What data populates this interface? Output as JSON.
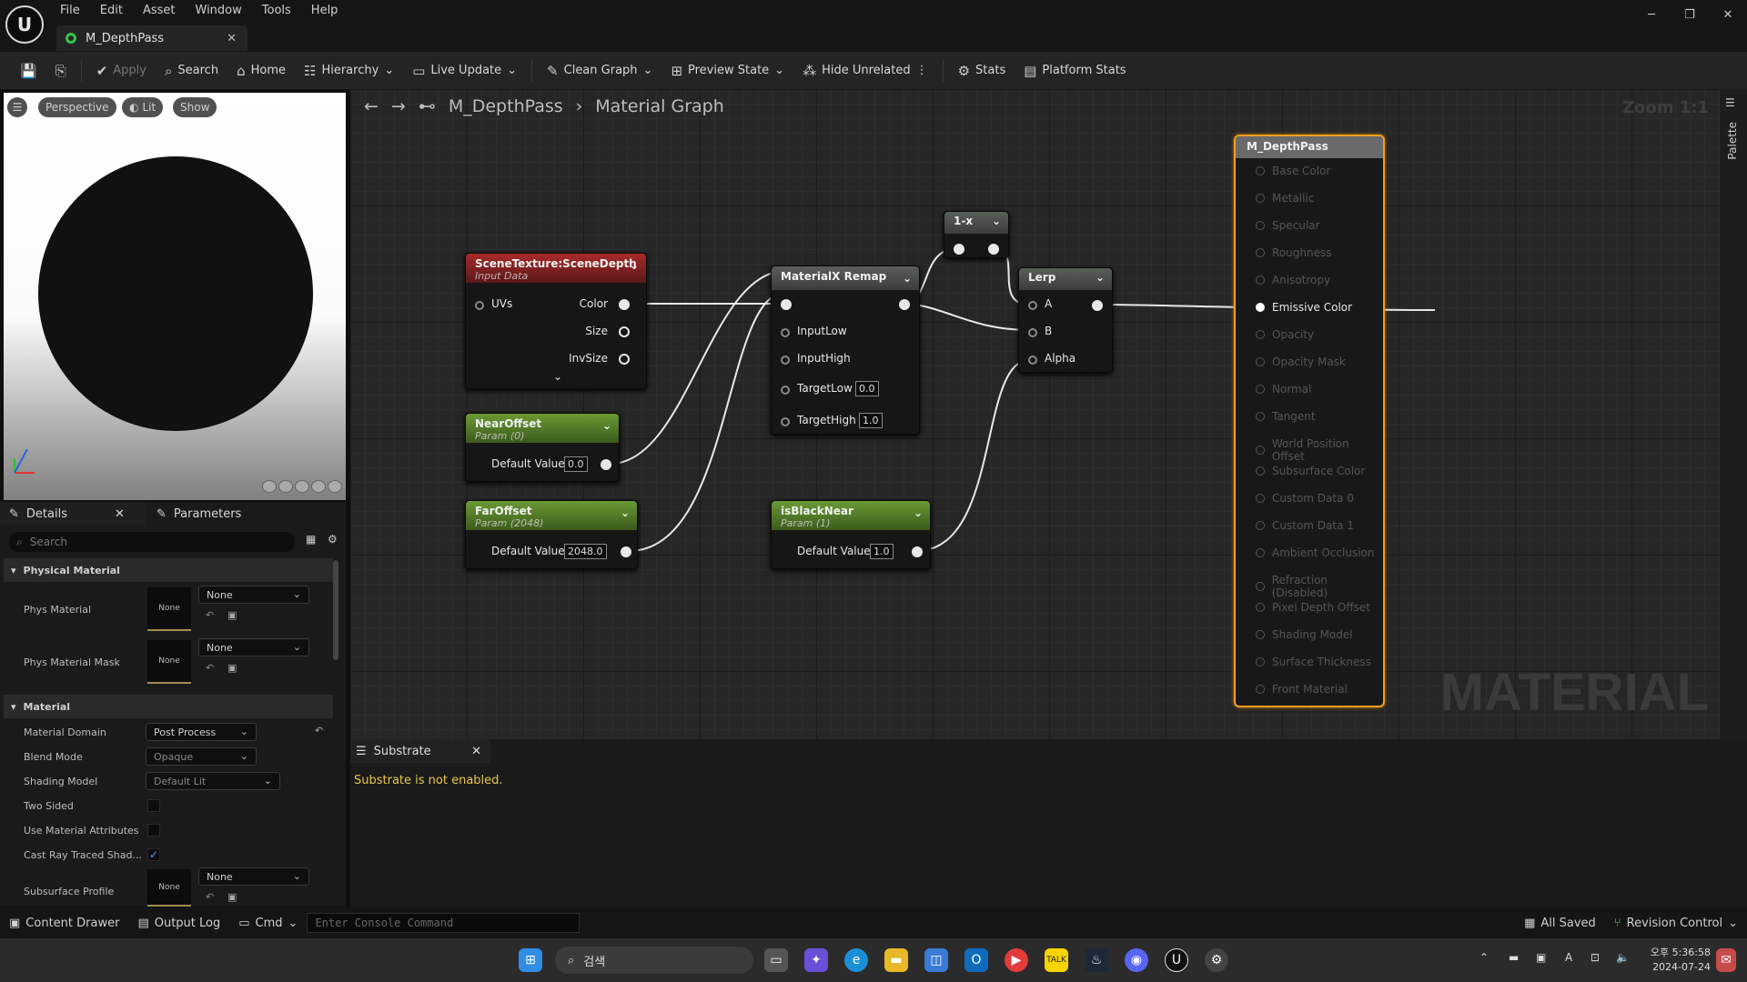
{
  "app": {
    "menu": [
      "File",
      "Edit",
      "Asset",
      "Window",
      "Tools",
      "Help"
    ],
    "tab_title": "M_DepthPass",
    "logo": "unreal-logo"
  },
  "toolbar": {
    "save": "save-icon",
    "browse": "browse-icon",
    "apply": "Apply",
    "search": "Search",
    "home": "Home",
    "hierarchy": "Hierarchy",
    "live_update": "Live Update",
    "clean_graph": "Clean Graph",
    "preview_state": "Preview State",
    "hide_unrelated": "Hide Unrelated",
    "stats": "Stats",
    "platform_stats": "Platform Stats"
  },
  "viewport": {
    "perspective": "Perspective",
    "lit": "Lit",
    "show": "Show"
  },
  "details": {
    "tab_details": "Details",
    "tab_parameters": "Parameters",
    "search_placeholder": "Search",
    "sections": {
      "physical_material": "Physical Material",
      "material": "Material"
    },
    "phys_material": {
      "label": "Phys Material",
      "thumb": "None",
      "value": "None"
    },
    "phys_material_mask": {
      "label": "Phys Material Mask",
      "thumb": "None",
      "value": "None"
    },
    "material_domain": {
      "label": "Material Domain",
      "value": "Post Process"
    },
    "blend_mode": {
      "label": "Blend Mode",
      "value": "Opaque"
    },
    "shading_model": {
      "label": "Shading Model",
      "value": "Default Lit"
    },
    "two_sided": {
      "label": "Two Sided"
    },
    "use_material_attributes": {
      "label": "Use Material Attributes"
    },
    "cast_ray": {
      "label": "Cast Ray Traced Shad...",
      "checked": true
    },
    "subsurface_profile": {
      "label": "Subsurface Profile",
      "thumb": "None",
      "value": "None"
    }
  },
  "graph": {
    "breadcrumb_asset": "M_DepthPass",
    "breadcrumb_graph": "Material Graph",
    "zoom": "Zoom 1:1",
    "watermark": "MATERIAL",
    "palette": "Palette",
    "scene_texture": {
      "title": "SceneTexture:SceneDepth",
      "sub": "Input Data",
      "uvs": "UVs",
      "color": "Color",
      "size": "Size",
      "invsize": "InvSize"
    },
    "near_offset": {
      "title": "NearOffset",
      "sub": "Param (0)",
      "label": "Default Value",
      "value": "0.0"
    },
    "far_offset": {
      "title": "FarOffset",
      "sub": "Param (2048)",
      "label": "Default Value",
      "value": "2048.0"
    },
    "remap": {
      "title": "MaterialX Remap",
      "input_low": "InputLow",
      "input_high": "InputHigh",
      "target_low": "TargetLow",
      "target_low_val": "0.0",
      "target_high": "TargetHigh",
      "target_high_val": "1.0"
    },
    "one_minus": {
      "title": "1-x"
    },
    "lerp": {
      "title": "Lerp",
      "a": "A",
      "b": "B",
      "alpha": "Alpha"
    },
    "is_black_near": {
      "title": "isBlackNear",
      "sub": "Param (1)",
      "label": "Default Value",
      "value": "1.0"
    },
    "output": {
      "title": "M_DepthPass",
      "pins": [
        "Base Color",
        "Metallic",
        "Specular",
        "Roughness",
        "Anisotropy",
        "Emissive Color",
        "Opacity",
        "Opacity Mask",
        "Normal",
        "Tangent",
        "World Position Offset",
        "Subsurface Color",
        "Custom Data 0",
        "Custom Data 1",
        "Ambient Occlusion",
        "Refraction (Disabled)",
        "Pixel Depth Offset",
        "Shading Model",
        "Surface Thickness",
        "Front Material"
      ],
      "active": "Emissive Color"
    }
  },
  "substrate": {
    "tab": "Substrate",
    "message": "Substrate is not enabled.",
    "message_color": "#e8c84a"
  },
  "bottom": {
    "content_drawer": "Content Drawer",
    "output_log": "Output Log",
    "cmd": "Cmd",
    "console_placeholder": "Enter Console Command",
    "all_saved": "All Saved",
    "revision_control": "Revision Control"
  },
  "taskbar": {
    "search": "검색",
    "time": "오후 5:36:58",
    "date": "2024-07-24",
    "ime": "A"
  }
}
